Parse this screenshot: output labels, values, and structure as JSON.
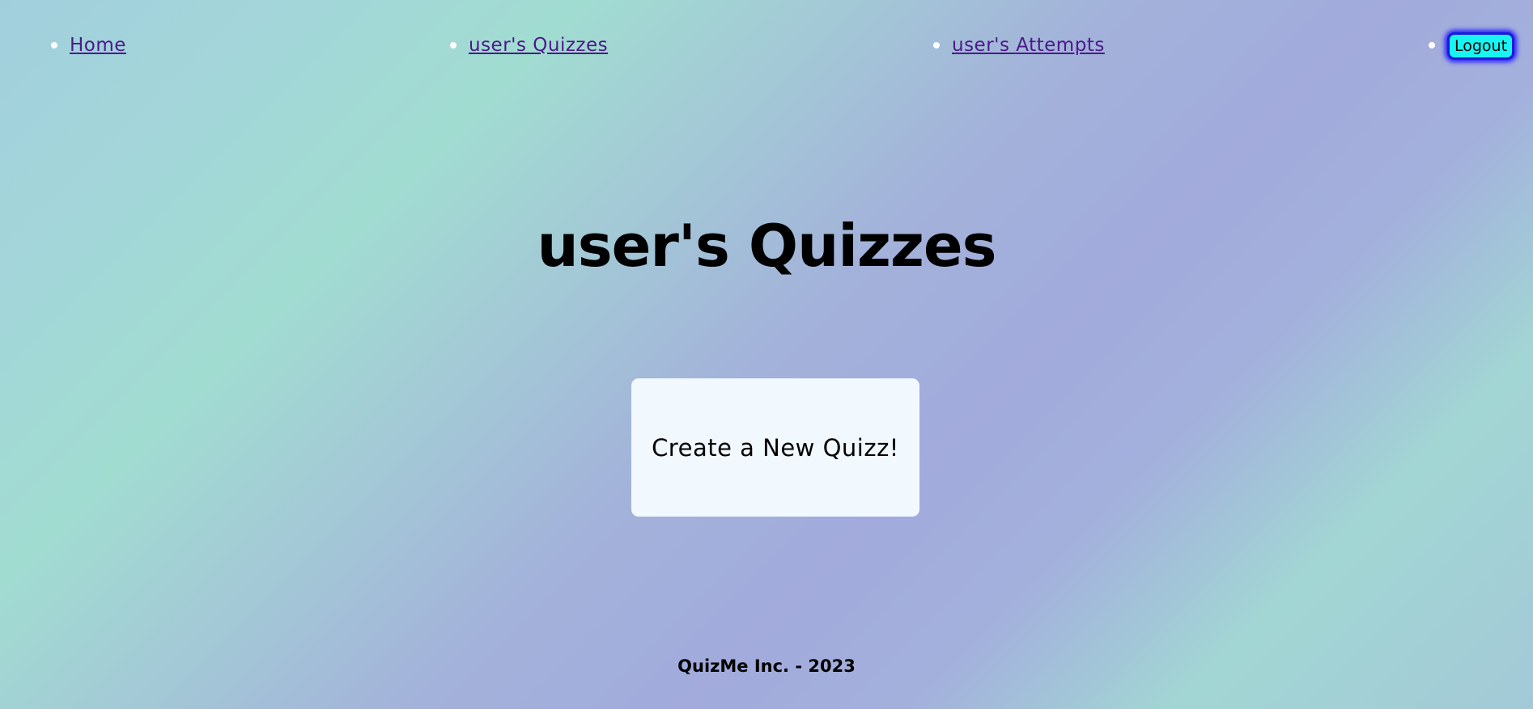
{
  "nav": {
    "items": [
      {
        "label": "Home"
      },
      {
        "label": "user's Quizzes"
      },
      {
        "label": "user's Attempts"
      }
    ],
    "logout_label": "Logout"
  },
  "main": {
    "title": "user's Quizzes",
    "create_label": "Create a New Quizz!"
  },
  "footer": {
    "text": "QuizMe Inc. - 2023"
  },
  "colors": {
    "link": "#4b1a8a",
    "logout_bg": "#18f4f1",
    "logout_border": "#1a1ad9",
    "card_bg": "#f1f8fe"
  }
}
